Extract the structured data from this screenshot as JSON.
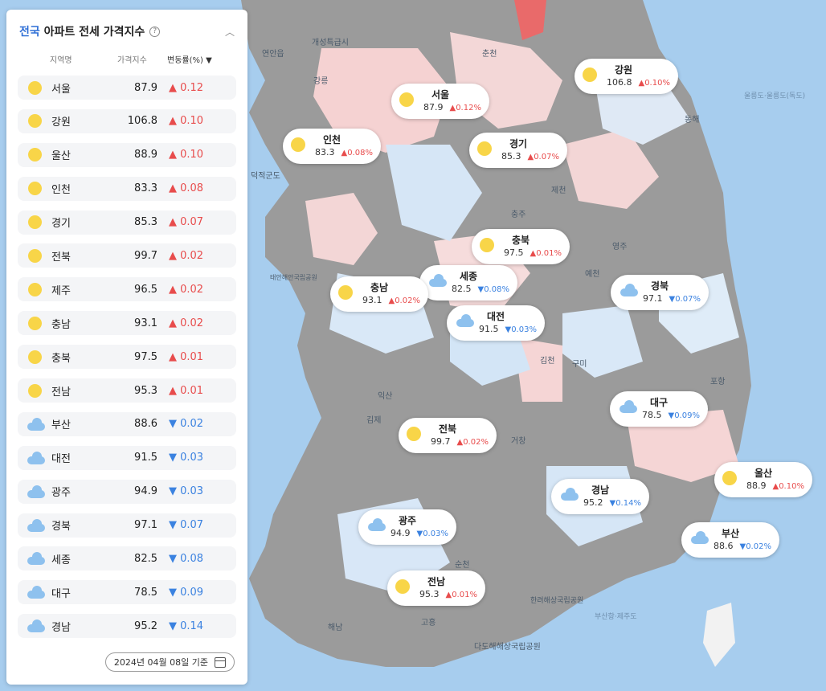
{
  "panel": {
    "title_accent": "전국",
    "title_rest": "아파트 전세 가격지수",
    "columns": {
      "name": "지역명",
      "index": "가격지수",
      "change": "변동률(%) ▼"
    },
    "items": [
      {
        "name": "서울",
        "index": "87.9",
        "change": "▲ 0.12",
        "dir": "up",
        "weather": "sun"
      },
      {
        "name": "강원",
        "index": "106.8",
        "change": "▲ 0.10",
        "dir": "up",
        "weather": "sun"
      },
      {
        "name": "울산",
        "index": "88.9",
        "change": "▲ 0.10",
        "dir": "up",
        "weather": "sun"
      },
      {
        "name": "인천",
        "index": "83.3",
        "change": "▲ 0.08",
        "dir": "up",
        "weather": "sun"
      },
      {
        "name": "경기",
        "index": "85.3",
        "change": "▲ 0.07",
        "dir": "up",
        "weather": "sun"
      },
      {
        "name": "전북",
        "index": "99.7",
        "change": "▲ 0.02",
        "dir": "up",
        "weather": "sun"
      },
      {
        "name": "제주",
        "index": "96.5",
        "change": "▲ 0.02",
        "dir": "up",
        "weather": "sun"
      },
      {
        "name": "충남",
        "index": "93.1",
        "change": "▲ 0.02",
        "dir": "up",
        "weather": "sun"
      },
      {
        "name": "충북",
        "index": "97.5",
        "change": "▲ 0.01",
        "dir": "up",
        "weather": "sun"
      },
      {
        "name": "전남",
        "index": "95.3",
        "change": "▲ 0.01",
        "dir": "up",
        "weather": "sun"
      },
      {
        "name": "부산",
        "index": "88.6",
        "change": "▼ 0.02",
        "dir": "down",
        "weather": "cloud"
      },
      {
        "name": "대전",
        "index": "91.5",
        "change": "▼ 0.03",
        "dir": "down",
        "weather": "cloud"
      },
      {
        "name": "광주",
        "index": "94.9",
        "change": "▼ 0.03",
        "dir": "down",
        "weather": "cloud"
      },
      {
        "name": "경북",
        "index": "97.1",
        "change": "▼ 0.07",
        "dir": "down",
        "weather": "cloud"
      },
      {
        "name": "세종",
        "index": "82.5",
        "change": "▼ 0.08",
        "dir": "down",
        "weather": "cloud"
      },
      {
        "name": "대구",
        "index": "78.5",
        "change": "▼ 0.09",
        "dir": "down",
        "weather": "cloud"
      },
      {
        "name": "경남",
        "index": "95.2",
        "change": "▼ 0.14",
        "dir": "down",
        "weather": "cloud"
      }
    ],
    "date_label": "2024년 04월 08일 기준"
  },
  "map_bubbles": [
    {
      "name": "강원",
      "index": "106.8",
      "change": "▲0.10%",
      "dir": "up",
      "weather": "sun"
    },
    {
      "name": "서울",
      "index": "87.9",
      "change": "▲0.12%",
      "dir": "up",
      "weather": "sun"
    },
    {
      "name": "인천",
      "index": "83.3",
      "change": "▲0.08%",
      "dir": "up",
      "weather": "sun"
    },
    {
      "name": "경기",
      "index": "85.3",
      "change": "▲0.07%",
      "dir": "up",
      "weather": "sun"
    },
    {
      "name": "충북",
      "index": "97.5",
      "change": "▲0.01%",
      "dir": "up",
      "weather": "sun"
    },
    {
      "name": "세종",
      "index": "82.5",
      "change": "▼0.08%",
      "dir": "down",
      "weather": "cloud"
    },
    {
      "name": "충남",
      "index": "93.1",
      "change": "▲0.02%",
      "dir": "up",
      "weather": "sun"
    },
    {
      "name": "경북",
      "index": "97.1",
      "change": "▼0.07%",
      "dir": "down",
      "weather": "cloud"
    },
    {
      "name": "대전",
      "index": "91.5",
      "change": "▼0.03%",
      "dir": "down",
      "weather": "cloud"
    },
    {
      "name": "대구",
      "index": "78.5",
      "change": "▼0.09%",
      "dir": "down",
      "weather": "cloud"
    },
    {
      "name": "전북",
      "index": "99.7",
      "change": "▲0.02%",
      "dir": "up",
      "weather": "sun"
    },
    {
      "name": "울산",
      "index": "88.9",
      "change": "▲0.10%",
      "dir": "up",
      "weather": "sun"
    },
    {
      "name": "경남",
      "index": "95.2",
      "change": "▼0.14%",
      "dir": "down",
      "weather": "cloud"
    },
    {
      "name": "광주",
      "index": "94.9",
      "change": "▼0.03%",
      "dir": "down",
      "weather": "cloud"
    },
    {
      "name": "부산",
      "index": "88.6",
      "change": "▼0.02%",
      "dir": "down",
      "weather": "cloud"
    },
    {
      "name": "전남",
      "index": "95.3",
      "change": "▲0.01%",
      "dir": "up",
      "weather": "sun"
    }
  ],
  "map_labels": [
    "개성특급시",
    "연안읍",
    "덕적군도",
    "태안해안국립공원",
    "다도해해상국립공원",
    "한려해상국립공원",
    "울릉도·울릉도(독도)",
    "부산항·제주도",
    "춘천",
    "강릉",
    "제천",
    "충주",
    "영주",
    "예천",
    "김천",
    "구미",
    "포항",
    "거창",
    "익산",
    "김제",
    "순천",
    "고흥",
    "해남",
    "동해"
  ],
  "colors": {
    "up": "#e84c4c",
    "down": "#3b82e0",
    "sea": "#a7cdee",
    "land_gray": "#9a9a9a",
    "land_pink": "#f5d5d5",
    "land_blue": "#d9e8f7",
    "sun": "#f8d548",
    "cloud": "#8ec1ee"
  }
}
